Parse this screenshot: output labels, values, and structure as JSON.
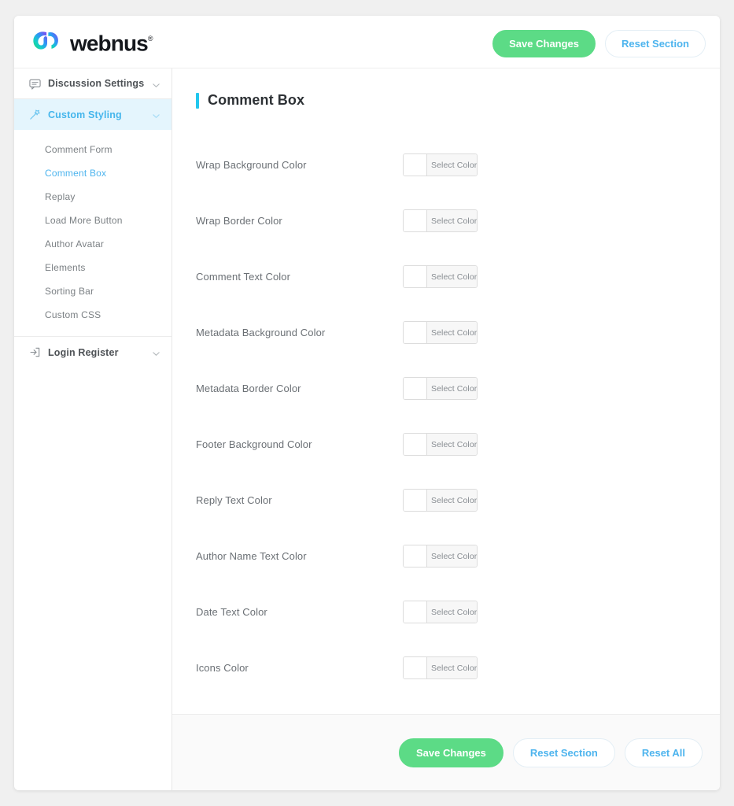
{
  "header": {
    "brand_name": "webnus",
    "brand_trademark": "®",
    "brand_icon": "webnus-logo-mark",
    "save_label": "Save Changes",
    "reset_label": "Reset Section"
  },
  "sidebar": {
    "groups": [
      {
        "label": "Discussion Settings",
        "icon": "comment-icon",
        "active": false,
        "chevron": "chevron-down-icon"
      },
      {
        "label": "Custom Styling",
        "icon": "magic-wand-icon",
        "active": true,
        "chevron": "chevron-down-icon"
      },
      {
        "label": "Login Register",
        "icon": "login-icon",
        "active": false,
        "chevron": "chevron-down-icon"
      }
    ],
    "sub_items": [
      {
        "label": "Comment Form",
        "active": false
      },
      {
        "label": "Comment Box",
        "active": true
      },
      {
        "label": "Replay",
        "active": false
      },
      {
        "label": "Load More Button",
        "active": false
      },
      {
        "label": "Author Avatar",
        "active": false
      },
      {
        "label": "Elements",
        "active": false
      },
      {
        "label": "Sorting Bar",
        "active": false
      },
      {
        "label": "Custom CSS",
        "active": false
      }
    ]
  },
  "main": {
    "section_title": "Comment Box",
    "select_color_label": "Select Color",
    "fields": [
      {
        "label": "Wrap Background Color",
        "value": "#ffffff"
      },
      {
        "label": "Wrap Border Color",
        "value": "#ffffff"
      },
      {
        "label": "Comment Text Color",
        "value": "#ffffff"
      },
      {
        "label": "Metadata Background Color",
        "value": "#ffffff"
      },
      {
        "label": "Metadata Border Color",
        "value": "#ffffff"
      },
      {
        "label": "Footer Background Color",
        "value": "#ffffff"
      },
      {
        "label": "Reply Text Color",
        "value": "#ffffff"
      },
      {
        "label": "Author Name Text Color",
        "value": "#ffffff"
      },
      {
        "label": "Date Text Color",
        "value": "#ffffff"
      },
      {
        "label": "Icons Color",
        "value": "#ffffff"
      }
    ]
  },
  "footer": {
    "save_label": "Save Changes",
    "reset_section_label": "Reset Section",
    "reset_all_label": "Reset All"
  },
  "colors": {
    "accent_green": "#5cdb86",
    "accent_blue": "#4db4ee",
    "title_bar_cyan": "#22c7ee",
    "active_nav_bg": "#e4f5fd",
    "page_bg": "#f0f0f0"
  }
}
